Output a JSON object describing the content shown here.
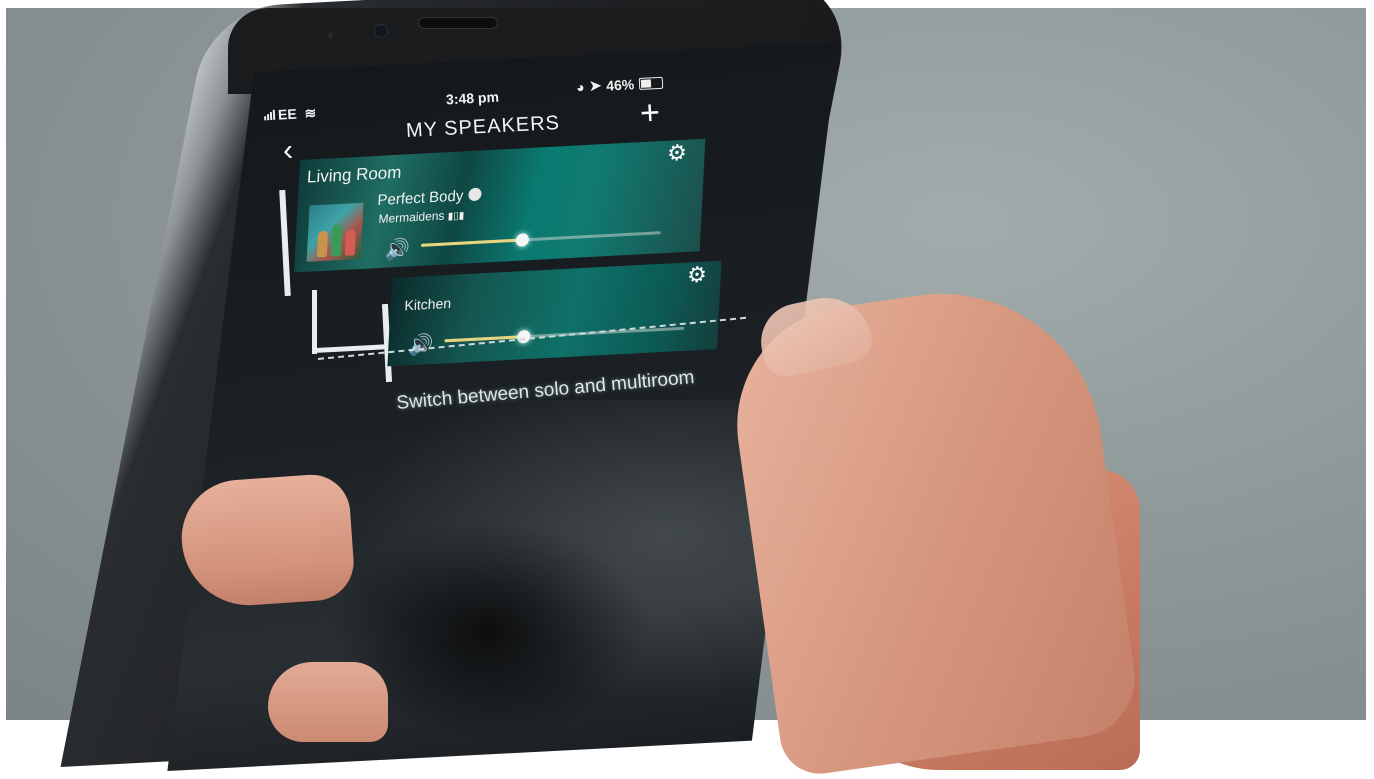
{
  "status_bar": {
    "carrier": "EE",
    "time": "3:48 pm",
    "battery": "46%"
  },
  "header": {
    "title": "MY SPEAKERS",
    "back_icon": "chevron-left-icon",
    "add_icon": "plus-icon"
  },
  "speakers": [
    {
      "room": "Living Room",
      "track": "Perfect Body",
      "artist": "Mermaidens",
      "volume": 0.42,
      "settings_icon": "gear-icon"
    },
    {
      "room": "Kitchen",
      "volume": 0.33,
      "settings_icon": "gear-icon"
    }
  ],
  "hint": "Switch between solo and multiroom",
  "colors": {
    "accent_fill": "#e6d57a",
    "card_teal": "#0e7168"
  }
}
